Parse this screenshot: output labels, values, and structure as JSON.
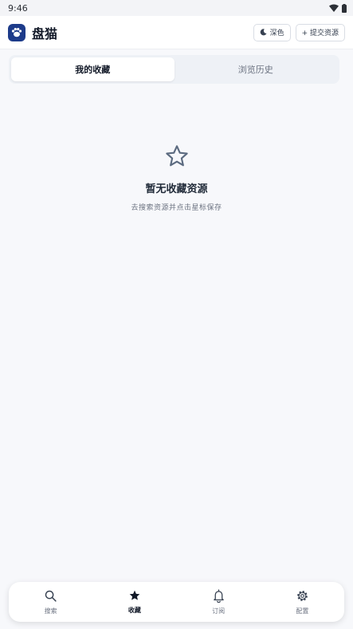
{
  "status_bar": {
    "time": "9:46"
  },
  "header": {
    "title": "盘猫",
    "theme_button": "深色",
    "submit_button": "+ 提交资源"
  },
  "tabs": [
    {
      "label": "我的收藏",
      "active": true
    },
    {
      "label": "浏览历史",
      "active": false
    }
  ],
  "empty_state": {
    "title": "暂无收藏资源",
    "subtitle": "去搜索资源并点击星标保存"
  },
  "bottom_nav": [
    {
      "label": "搜索",
      "icon": "search-icon",
      "active": false
    },
    {
      "label": "收藏",
      "icon": "star-icon",
      "active": true
    },
    {
      "label": "订阅",
      "icon": "bell-icon",
      "active": false
    },
    {
      "label": "配置",
      "icon": "gear-icon",
      "active": false
    }
  ],
  "colors": {
    "accent": "#1d3b8a",
    "background": "#f7f8fb"
  }
}
